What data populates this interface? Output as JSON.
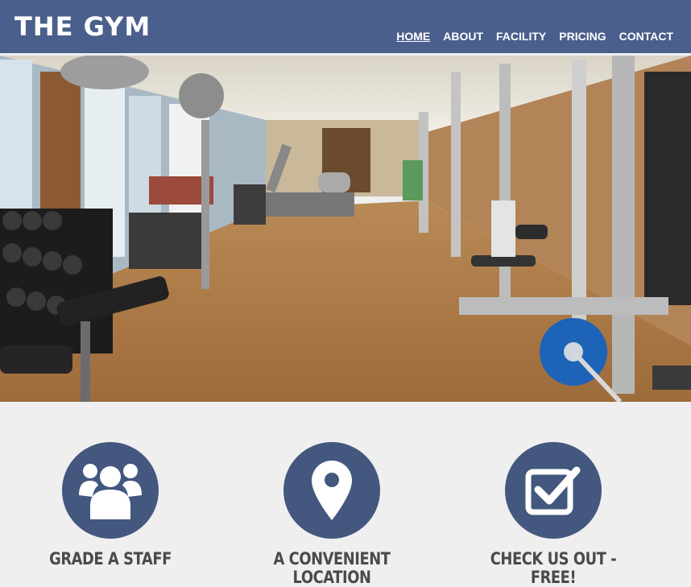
{
  "header": {
    "logo": "THE GYM",
    "nav": [
      {
        "label": "HOME",
        "active": true
      },
      {
        "label": "ABOUT"
      },
      {
        "label": "FACILITY"
      },
      {
        "label": "PRICING"
      },
      {
        "label": "CONTACT"
      }
    ]
  },
  "hero": {
    "icon": "gym-interior-photo"
  },
  "features": [
    {
      "title": "GRADE A STAFF",
      "icon": "group-icon"
    },
    {
      "title": "A CONVENIENT LOCATION",
      "icon": "map-pin-icon"
    },
    {
      "title": "CHECK US OUT - FREE!",
      "icon": "checkbox-icon"
    }
  ],
  "colors": {
    "header_bg": "#4a5f8c",
    "circle_bg": "#43577f",
    "page_bg": "#efefef",
    "title_text": "#4a4a4a"
  }
}
